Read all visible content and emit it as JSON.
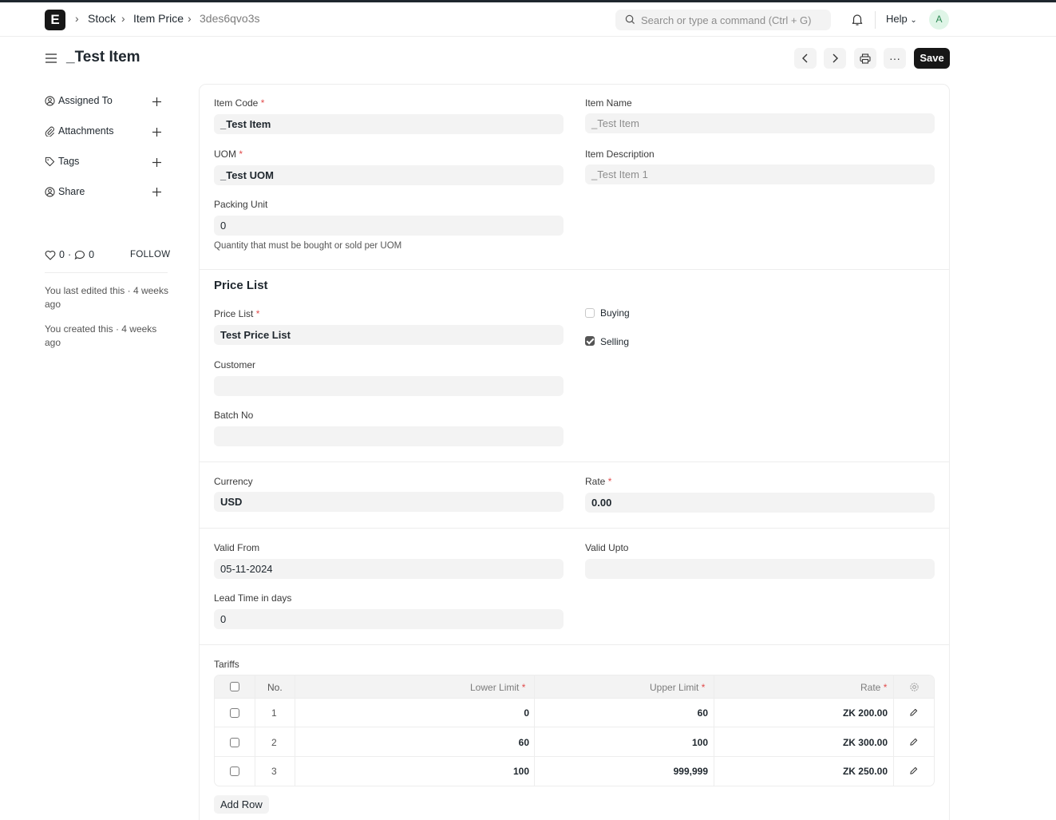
{
  "navbar": {
    "logo_letter": "E",
    "breadcrumbs": [
      "Stock",
      "Item Price",
      "3des6qvo3s"
    ],
    "search_placeholder": "Search or type a command (Ctrl + G)",
    "help_label": "Help",
    "avatar_initial": "A"
  },
  "page": {
    "title": "_Test Item",
    "save_label": "Save"
  },
  "sidebar": {
    "items": [
      {
        "label": "Assigned To"
      },
      {
        "label": "Attachments"
      },
      {
        "label": "Tags"
      },
      {
        "label": "Share"
      }
    ],
    "likes": "0",
    "comments": "0",
    "follow_label": "FOLLOW",
    "last_edited": "You last edited this · 4 weeks ago",
    "created": "You created this · 4 weeks ago"
  },
  "form": {
    "item_code": {
      "label": "Item Code",
      "value": "_Test Item"
    },
    "item_name": {
      "label": "Item Name",
      "value": "_Test Item"
    },
    "uom": {
      "label": "UOM",
      "value": "_Test UOM"
    },
    "item_description": {
      "label": "Item Description",
      "value": "_Test Item 1"
    },
    "packing_unit": {
      "label": "Packing Unit",
      "value": "0",
      "help": "Quantity that must be bought or sold per UOM"
    },
    "price_list_section": "Price List",
    "price_list": {
      "label": "Price List",
      "value": "Test Price List"
    },
    "buying": {
      "label": "Buying",
      "checked": false
    },
    "selling": {
      "label": "Selling",
      "checked": true
    },
    "customer": {
      "label": "Customer",
      "value": ""
    },
    "batch_no": {
      "label": "Batch No",
      "value": ""
    },
    "currency": {
      "label": "Currency",
      "value": "USD"
    },
    "rate": {
      "label": "Rate",
      "value": "0.00"
    },
    "valid_from": {
      "label": "Valid From",
      "value": "05-11-2024"
    },
    "valid_upto": {
      "label": "Valid Upto",
      "value": ""
    },
    "lead_time": {
      "label": "Lead Time in days",
      "value": "0"
    }
  },
  "tariffs": {
    "label": "Tariffs",
    "columns": {
      "no": "No.",
      "lower": "Lower Limit",
      "upper": "Upper Limit",
      "rate": "Rate"
    },
    "rows": [
      {
        "no": "1",
        "lower": "0",
        "upper": "60",
        "rate": "ZK 200.00"
      },
      {
        "no": "2",
        "lower": "60",
        "upper": "100",
        "rate": "ZK 300.00"
      },
      {
        "no": "3",
        "lower": "100",
        "upper": "999,999",
        "rate": "ZK 250.00"
      }
    ],
    "add_row_label": "Add Row"
  }
}
